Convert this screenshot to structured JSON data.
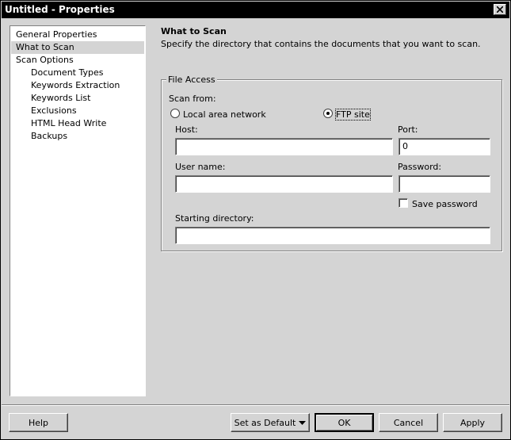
{
  "window": {
    "title": "Untitled - Properties"
  },
  "nav": {
    "items": [
      {
        "label": "General Properties",
        "level": 0
      },
      {
        "label": "What to Scan",
        "level": 0,
        "selected": true
      },
      {
        "label": "Scan Options",
        "level": 0
      },
      {
        "label": "Document Types",
        "level": 1
      },
      {
        "label": "Keywords Extraction",
        "level": 1
      },
      {
        "label": "Keywords List",
        "level": 1
      },
      {
        "label": "Exclusions",
        "level": 1
      },
      {
        "label": "HTML Head Write",
        "level": 1
      },
      {
        "label": "Backups",
        "level": 1
      }
    ]
  },
  "content": {
    "title": "What to Scan",
    "description": "Specify the directory that contains the documents that you want to scan."
  },
  "file_access": {
    "legend": "File Access",
    "scan_from_label": "Scan from:",
    "option_lan": "Local area network",
    "option_ftp": "FTP site",
    "selected_option": "FTP site",
    "host_label": "Host:",
    "host_value": "",
    "port_label": "Port:",
    "port_value": "0",
    "username_label": "User name:",
    "username_value": "",
    "password_label": "Password:",
    "password_value": "",
    "save_password_label": "Save password",
    "save_password_checked": false,
    "starting_dir_label": "Starting directory:",
    "starting_dir_value": ""
  },
  "buttons": {
    "help": "Help",
    "set_as_default": "Set as Default",
    "ok": "OK",
    "cancel": "Cancel",
    "apply": "Apply"
  }
}
